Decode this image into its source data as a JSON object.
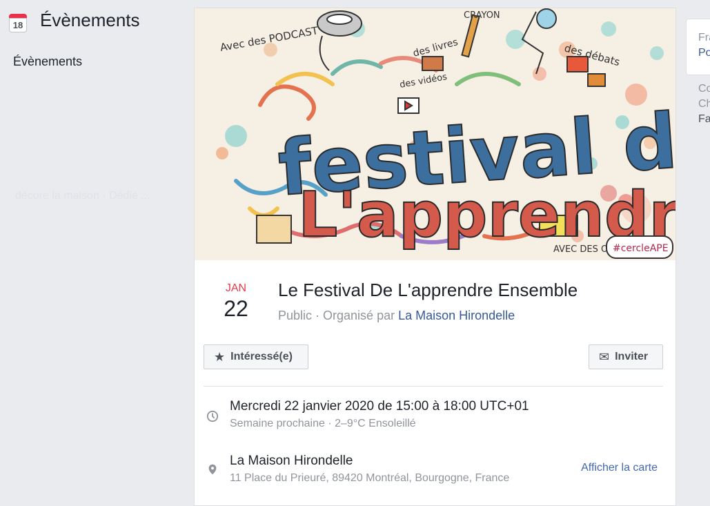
{
  "sidebar": {
    "header_title": "Évènements",
    "calendar_day": "18",
    "item": "Évènements",
    "ghost_text": "décore la maison · Dédié ..."
  },
  "event": {
    "month": "JAN",
    "day": "22",
    "title": "Le Festival De L'apprendre Ensemble",
    "privacy": "Public",
    "organized_prefix": " · Organisé par ",
    "organizer": "La Maison Hirondelle",
    "cover_texts": {
      "title_line1": "festival de",
      "title_line2": "L'apprendre",
      "podcast": "Avec des PODCAST",
      "crayon": "CRAYON",
      "livres": "des livres",
      "videos": "des vidéos",
      "debats": "des débats",
      "objets": "AVEC DES OBJETS",
      "hashtag": "#cercleAPE"
    }
  },
  "actions": {
    "interested_label": "Intéressé(e)",
    "invite_label": "Inviter"
  },
  "details": {
    "datetime": "Mercredi 22 janvier 2020 de 15:00 à 18:00 UTC+01",
    "datetime_sub": "Semaine prochaine · 2–9°C Ensoleillé",
    "place": "La Maison Hirondelle",
    "address": "11 Place du Prieuré, 89420 Montréal, Bourgogne, France",
    "map_link": "Afficher la carte"
  },
  "right_panel": {
    "line1": "Fra",
    "line2": "Po",
    "line3": "Co",
    "line4": "Ch",
    "line5": "Fa"
  },
  "colors": {
    "background": "#e9ebee",
    "link": "#365899",
    "accent_red": "#e6394b",
    "muted": "#90949c"
  }
}
